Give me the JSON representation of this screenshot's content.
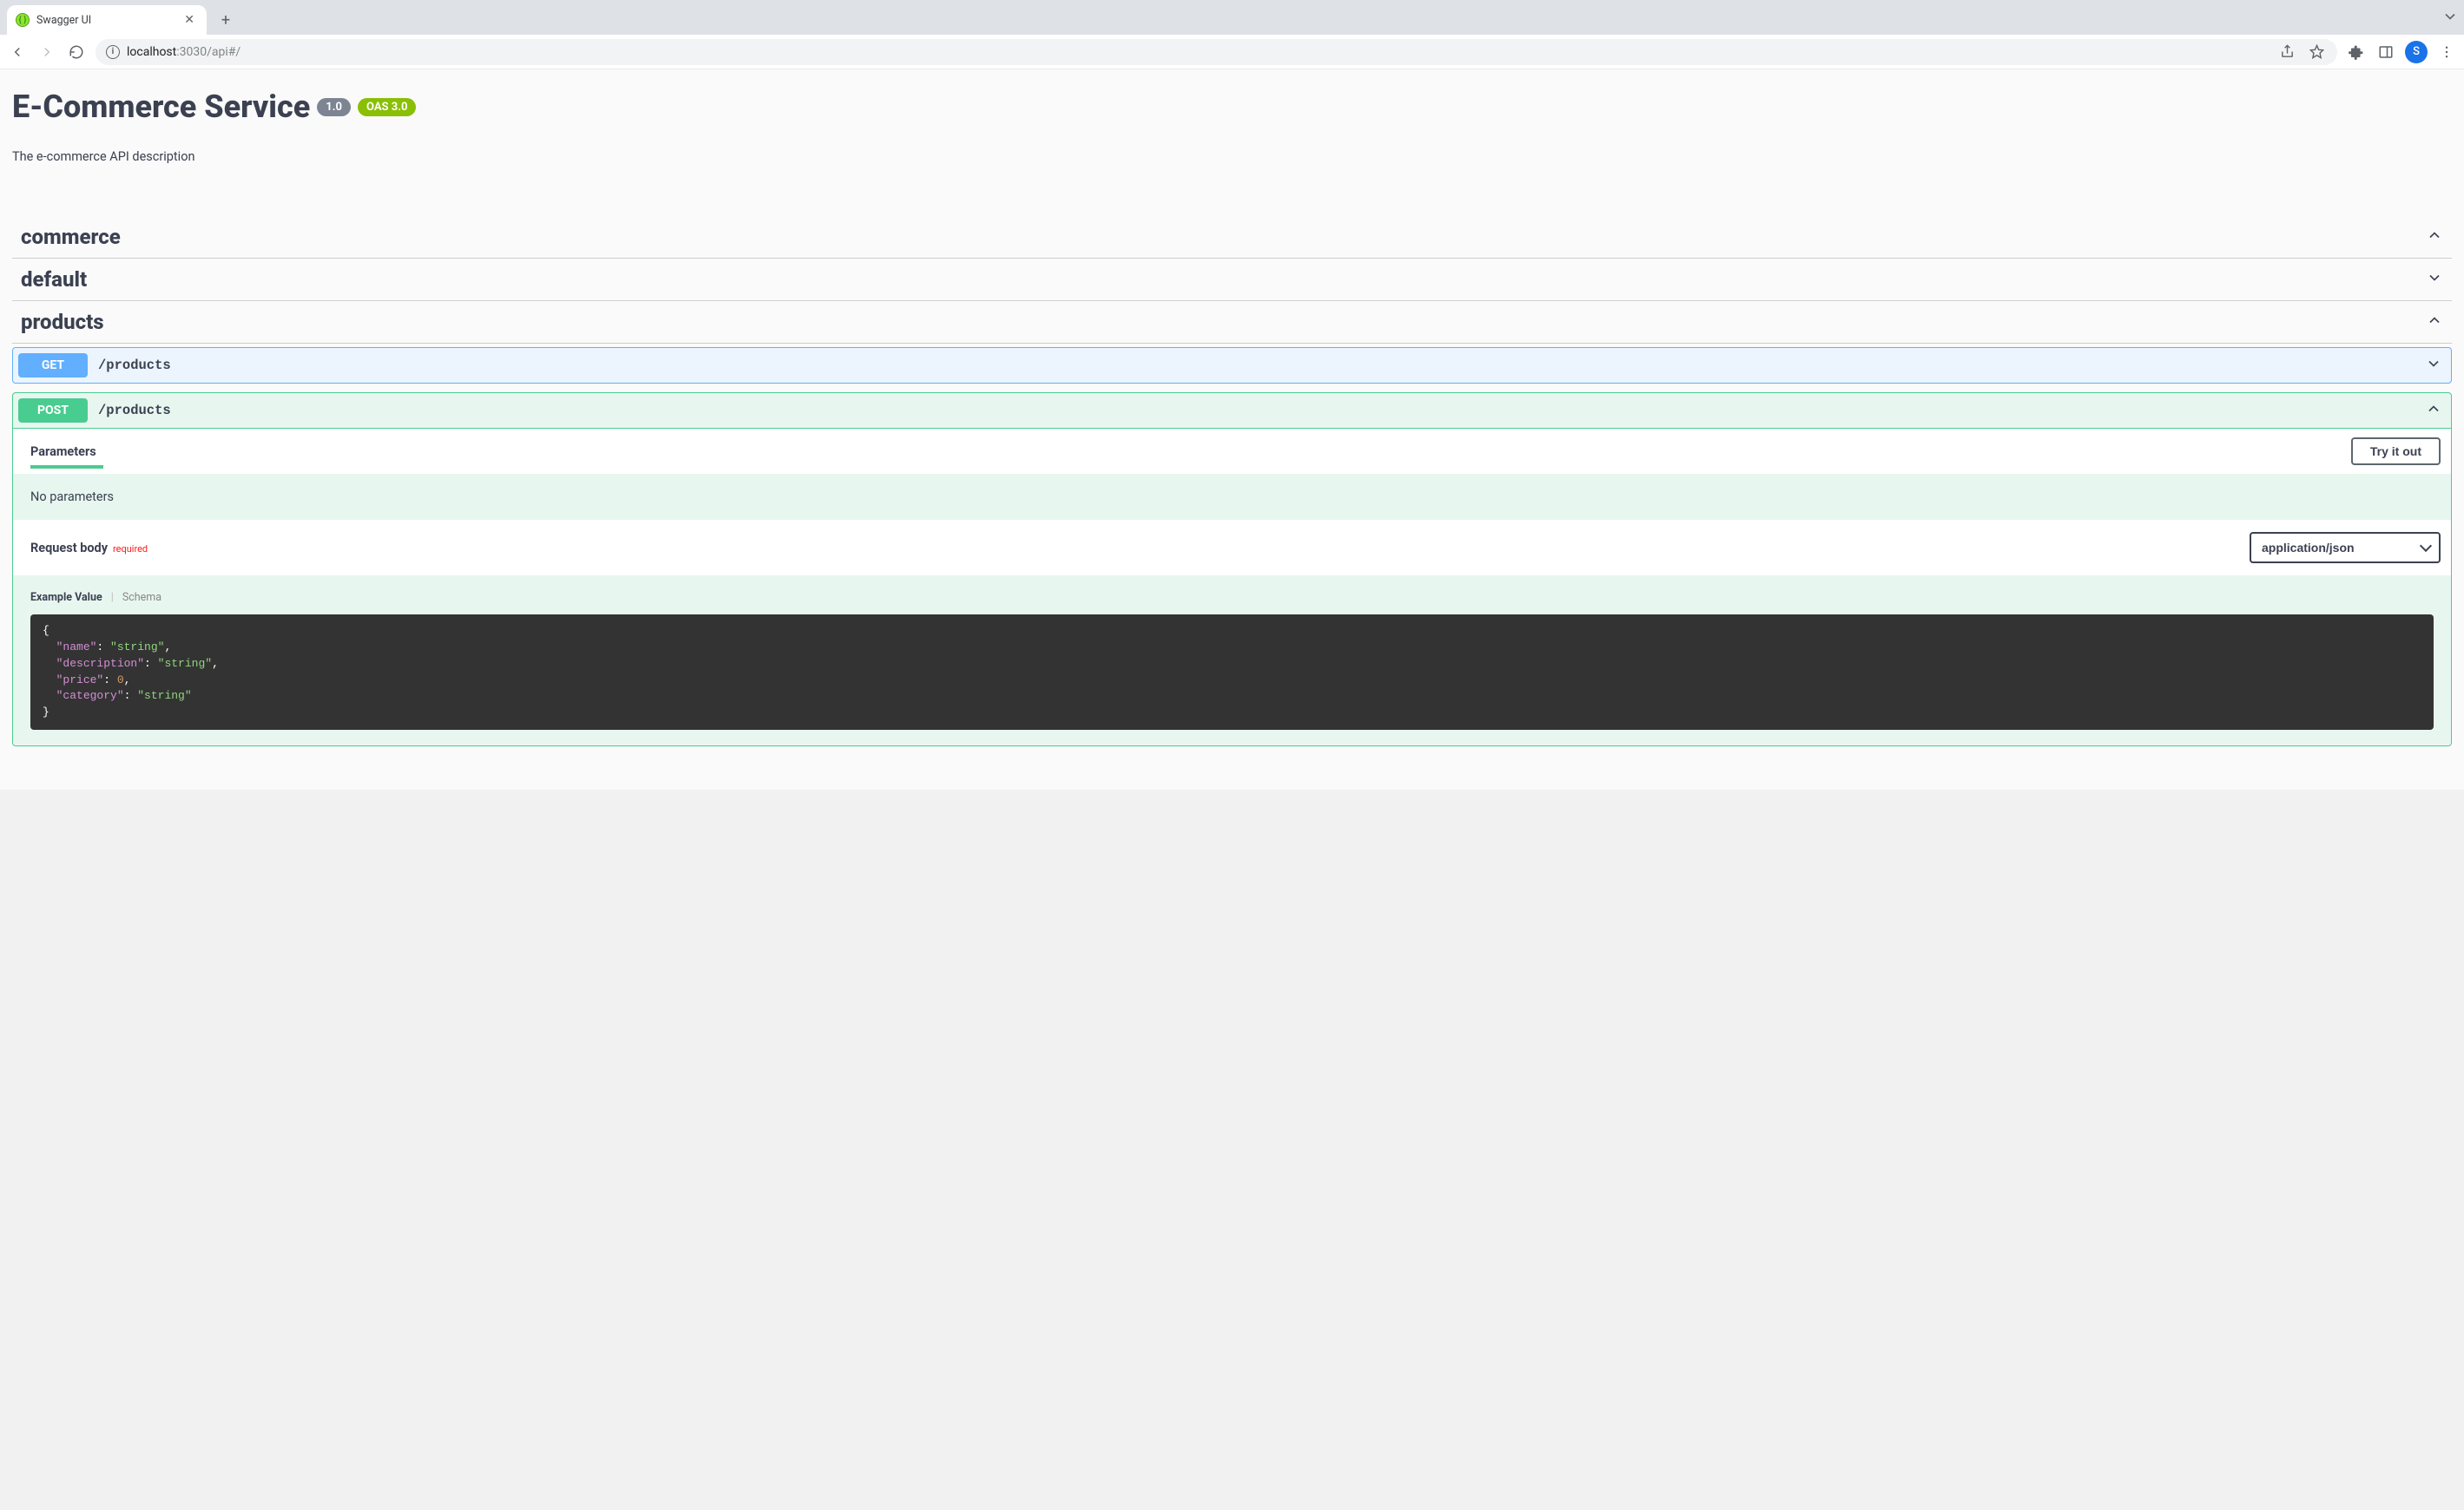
{
  "browser": {
    "tab_title": "Swagger UI",
    "url_host": "localhost",
    "url_rest": ":3030/api#/",
    "avatar_letter": "S"
  },
  "header": {
    "title": "E-Commerce Service",
    "version": "1.0",
    "oas": "OAS 3.0",
    "description": "The e-commerce API description"
  },
  "sections": {
    "commerce": {
      "name": "commerce"
    },
    "default": {
      "name": "default"
    },
    "products": {
      "name": "products"
    }
  },
  "ops": {
    "get_products": {
      "method": "GET",
      "path": "/products"
    },
    "post_products": {
      "method": "POST",
      "path": "/products",
      "parameters_heading": "Parameters",
      "try_it_out": "Try it out",
      "no_parameters": "No parameters",
      "request_body_heading": "Request body",
      "required_label": "required",
      "content_type": "application/json",
      "example_value_label": "Example Value",
      "schema_label": "Schema"
    }
  },
  "example_json": {
    "lines": [
      {
        "type": "open"
      },
      {
        "type": "kv_str",
        "key": "name",
        "value": "string",
        "comma": true
      },
      {
        "type": "kv_str",
        "key": "description",
        "value": "string",
        "comma": true
      },
      {
        "type": "kv_num",
        "key": "price",
        "value": 0,
        "comma": true
      },
      {
        "type": "kv_str",
        "key": "category",
        "value": "string",
        "comma": false
      },
      {
        "type": "close"
      }
    ]
  }
}
